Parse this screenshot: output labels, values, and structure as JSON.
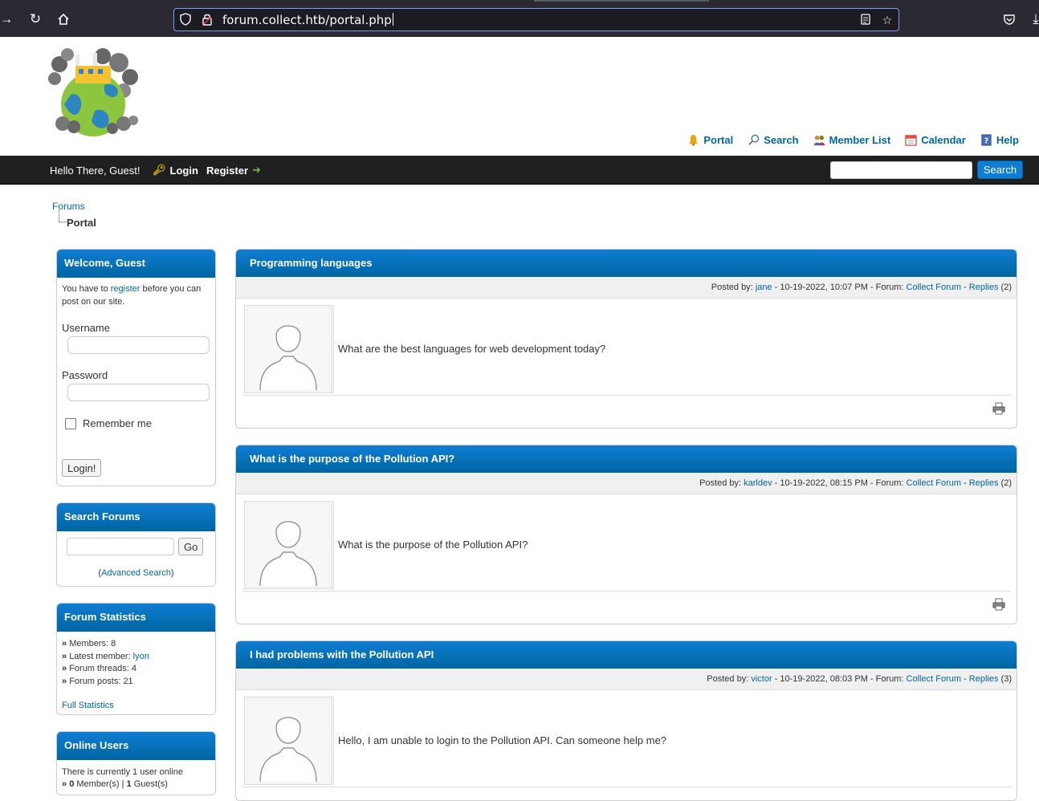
{
  "browser": {
    "url": "forum.collect.htb/portal.php"
  },
  "header": {
    "top_links": [
      {
        "label": "Portal",
        "icon": "portal-icon"
      },
      {
        "label": "Search",
        "icon": "search-icon"
      },
      {
        "label": "Member List",
        "icon": "members-icon"
      },
      {
        "label": "Calendar",
        "icon": "calendar-icon"
      },
      {
        "label": "Help",
        "icon": "help-icon"
      }
    ]
  },
  "navbar": {
    "greeting": "Hello There, Guest!",
    "login_label": "Login",
    "register_label": "Register",
    "search_button": "Search"
  },
  "breadcrumb": {
    "root": "Forums",
    "current": "Portal"
  },
  "welcome_box": {
    "title": "Welcome, Guest",
    "text_before": "You have to ",
    "register_link": "register",
    "text_after": " before you can post on our site.",
    "username_label": "Username",
    "password_label": "Password",
    "remember_label": "Remember me",
    "login_button": "Login!"
  },
  "search_box": {
    "title": "Search Forums",
    "go_button": "Go",
    "advanced_open": "(",
    "advanced_link": "Advanced Search",
    "advanced_close": ")"
  },
  "stats_box": {
    "title": "Forum Statistics",
    "members_label": "Members:",
    "members_value": "8",
    "latest_label": "Latest member:",
    "latest_value": "lyon",
    "threads_label": "Forum threads:",
    "threads_value": "4",
    "posts_label": "Forum posts:",
    "posts_value": "21",
    "full_link": "Full Statistics"
  },
  "online_box": {
    "title": "Online Users",
    "line1": "There is currently 1 user online",
    "members_count": "0",
    "members_text": "Member(s)",
    "guests_count": "1",
    "guests_text": "Guest(s)"
  },
  "posts": [
    {
      "title": "Programming languages",
      "posted_by_label": "Posted by:",
      "author": "jane",
      "date": "10-19-2022, 10:07 PM",
      "forum_label": "Forum:",
      "forum": "Collect Forum",
      "replies_label": "Replies",
      "replies": "(2)",
      "message": "What are the best languages for web development today?"
    },
    {
      "title": "What is the purpose of the Pollution API?",
      "posted_by_label": "Posted by:",
      "author": "karldev",
      "date": "10-19-2022, 08:15 PM",
      "forum_label": "Forum:",
      "forum": "Collect Forum",
      "replies_label": "Replies",
      "replies": "(2)",
      "message": "What is the purpose of the Pollution API?"
    },
    {
      "title": "I had problems with the Pollution API",
      "posted_by_label": "Posted by:",
      "author": "victor",
      "date": "10-19-2022, 08:03 PM",
      "forum_label": "Forum:",
      "forum": "Collect Forum",
      "replies_label": "Replies",
      "replies": "(3)",
      "message": "Hello, I am unable to login to the Pollution API. Can someone help me?"
    }
  ]
}
